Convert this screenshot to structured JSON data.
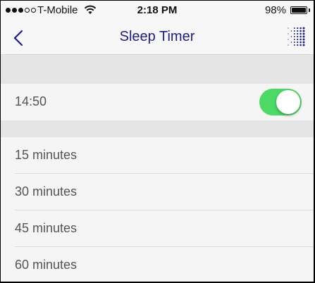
{
  "status_bar": {
    "carrier": "T-Mobile",
    "signal_bars_filled": 3,
    "signal_bars_total": 5,
    "time": "2:18 PM",
    "battery": "98%",
    "battery_level": 0.98
  },
  "nav": {
    "title": "Sleep Timer",
    "back_icon": "chevron-left-icon",
    "right_icon": "dot-grid-icon"
  },
  "timer": {
    "value": "14:50",
    "enabled": true
  },
  "options": [
    {
      "label": "15 minutes"
    },
    {
      "label": "30 minutes"
    },
    {
      "label": "45 minutes"
    },
    {
      "label": "60 minutes"
    }
  ],
  "colors": {
    "accent": "#1c1d8a",
    "toggle_on": "#4cd964"
  }
}
